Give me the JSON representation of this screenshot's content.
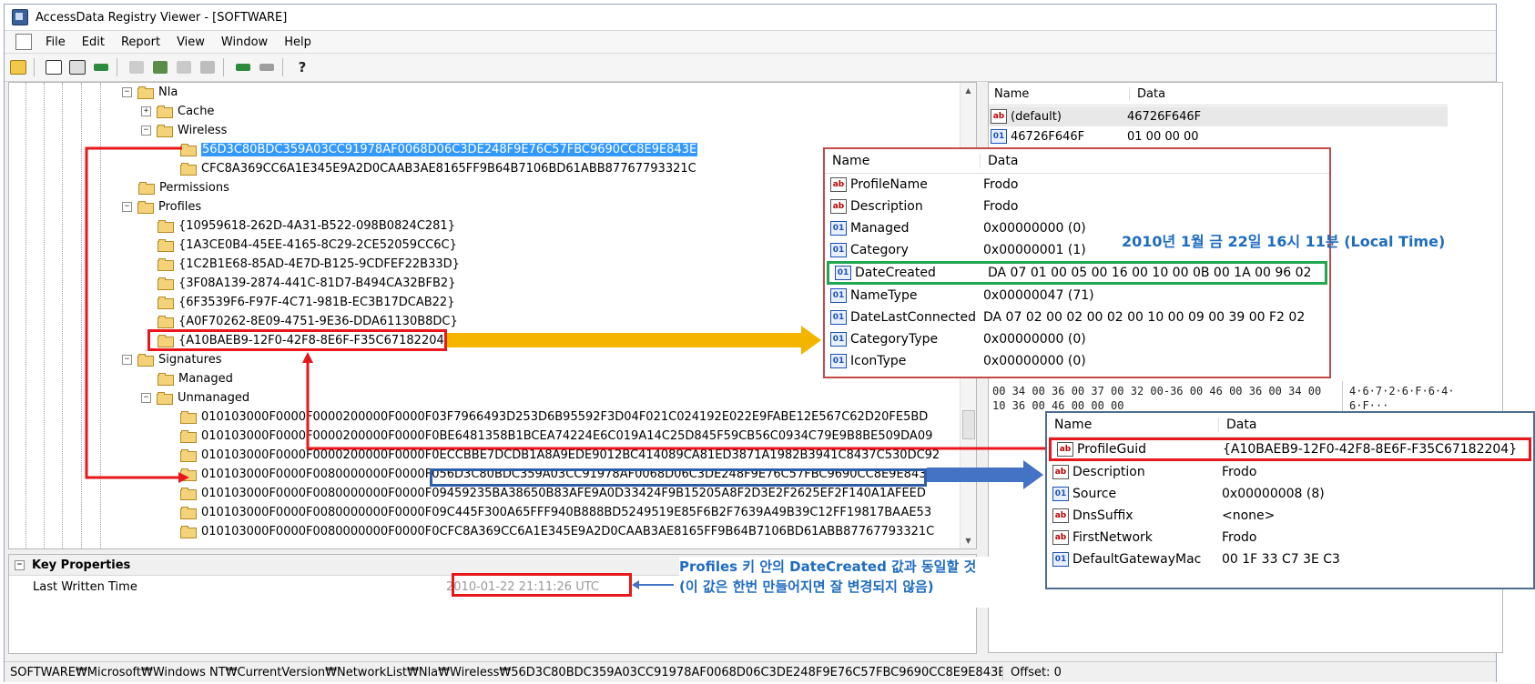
{
  "window": {
    "title": "AccessData Registry Viewer - [SOFTWARE]"
  },
  "menu": {
    "items": [
      "File",
      "Edit",
      "Report",
      "View",
      "Window",
      "Help"
    ]
  },
  "toolbar": {
    "icons": [
      "open-folder-icon",
      "report-icon",
      "export-icon",
      "key-icon",
      "disabled-icon",
      "find-icon",
      "properties-icon",
      "search-icon",
      "connect-icon",
      "disconnect-icon",
      "help-icon"
    ]
  },
  "tree": {
    "nodes": [
      {
        "label": "Nla",
        "expander": "−"
      },
      {
        "label": "Cache",
        "expander": "+"
      },
      {
        "label": "Wireless",
        "expander": "−"
      },
      {
        "label": "56D3C80BDC359A03CC91978AF0068D06C3DE248F9E76C57FBC9690CC8E9E843E",
        "expander": ""
      },
      {
        "label": "CFC8A369CC6A1E345E9A2D0CAAB3AE8165FF9B64B7106BD61ABB87767793321C",
        "expander": ""
      },
      {
        "label": "Permissions",
        "expander": ""
      },
      {
        "label": "Profiles",
        "expander": "−"
      },
      {
        "label": "{10959618-262D-4A31-B522-098B0824C281}",
        "expander": ""
      },
      {
        "label": "{1A3CE0B4-45EE-4165-8C29-2CE52059CC6C}",
        "expander": ""
      },
      {
        "label": "{1C2B1E68-85AD-4E7D-B125-9CDFEF22B33D}",
        "expander": ""
      },
      {
        "label": "{3F08A139-2874-441C-81D7-B494CA32BFB2}",
        "expander": ""
      },
      {
        "label": "{6F3539F6-F97F-4C71-981B-EC3B17DCAB22}",
        "expander": ""
      },
      {
        "label": "{A0F70262-8E09-4751-9E36-DDA61130B8DC}",
        "expander": ""
      },
      {
        "label": "{A10BAEB9-12F0-42F8-8E6F-F35C67182204}",
        "expander": ""
      },
      {
        "label": "Signatures",
        "expander": "−"
      },
      {
        "label": "Managed",
        "expander": ""
      },
      {
        "label": "Unmanaged",
        "expander": "−"
      },
      {
        "label": "010103000F0000F0000200000F0000F03F7966493D253D6B95592F3D04F021C024192E022E9FABE12E567C62D20FE5BD",
        "expander": ""
      },
      {
        "label": "010103000F0000F0000200000F0000F0BE6481358B1BCEA74224E6C019A14C25D845F59CB56C0934C79E9B8BE509DA09",
        "expander": ""
      },
      {
        "label": "010103000F0000F0000200000F0000F0ECCBBE7DCDB1A8A9EDE9012BC414089CA81ED3871A1982B3941C8437C530DC92",
        "expander": ""
      },
      {
        "label": "010103000F0000F0080000000F0000F056D3C80BDC359A03CC91978AF0068D06C3DE248F9E76C57FBC9690CC8E9E843E",
        "expander": ""
      },
      {
        "label": "010103000F0000F0080000000F0000F09459235BA38650B83AFE9A0D33424F9B15205A8F2D3E2F2625EF2F140A1AFEED",
        "expander": ""
      },
      {
        "label": "010103000F0000F0080000000F0000F09C445F300A65FFF940B888BD5249519E85F6B2F7639A49B39C12FF19817BAAE53",
        "expander": ""
      },
      {
        "label": "010103000F0000F0080000000F0000F0CFC8A369CC6A1E345E9A2D0CAAB3AE8165FF9B64B7106BD61ABB87767793321C",
        "expander": ""
      }
    ]
  },
  "key_properties": {
    "header": "Key Properties",
    "expander": "−",
    "last_written_label": "Last Written Time",
    "last_written_value": "2010-01-22 21:11:26 UTC"
  },
  "right_pane": {
    "col_name": "Name",
    "col_data": "Data",
    "rows": [
      {
        "name": "(default)",
        "data": "46726F646F",
        "type": "ab"
      },
      {
        "name": "46726F646F",
        "data": "01 00 00 00",
        "type": "bin"
      }
    ],
    "hex_line1": "00  34 00 36 00 37 00 32 00-36 00 46 00 36 00 34 00",
    "hex_line2": "10  36 00 46 00 00 00",
    "ascii_line1": "4·6·7·2·6·F·6·4·",
    "ascii_line2": "6·F···"
  },
  "popup_profile": {
    "col_name": "Name",
    "col_data": "Data",
    "rows": [
      {
        "name": "ProfileName",
        "data": "Frodo",
        "type": "ab"
      },
      {
        "name": "Description",
        "data": "Frodo",
        "type": "ab"
      },
      {
        "name": "Managed",
        "data": "0x00000000 (0)",
        "type": "bin"
      },
      {
        "name": "Category",
        "data": "0x00000001 (1)",
        "type": "bin"
      },
      {
        "name": "DateCreated",
        "data": "DA 07 01 00 05 00 16 00 10 00 0B 00 1A 00 96 02",
        "type": "bin"
      },
      {
        "name": "NameType",
        "data": "0x00000047 (71)",
        "type": "bin"
      },
      {
        "name": "DateLastConnected",
        "data": "DA 07 02 00 02 00 02 00 10 00 09 00 39 00 F2 02",
        "type": "bin"
      },
      {
        "name": "CategoryType",
        "data": "0x00000000 (0)",
        "type": "bin"
      },
      {
        "name": "IconType",
        "data": "0x00000000 (0)",
        "type": "bin"
      }
    ]
  },
  "popup_signature": {
    "col_name": "Name",
    "col_data": "Data",
    "rows": [
      {
        "name": "ProfileGuid",
        "data": "{A10BAEB9-12F0-42F8-8E6F-F35C67182204}",
        "type": "ab"
      },
      {
        "name": "Description",
        "data": "Frodo",
        "type": "ab"
      },
      {
        "name": "Source",
        "data": "0x00000008 (8)",
        "type": "bin"
      },
      {
        "name": "DnsSuffix",
        "data": "<none>",
        "type": "ab"
      },
      {
        "name": "FirstNetwork",
        "data": "Frodo",
        "type": "ab"
      },
      {
        "name": "DefaultGatewayMac",
        "data": "00 1F 33 C7 3E C3",
        "type": "bin"
      }
    ]
  },
  "annotations": {
    "date_decoded": "2010년 1월 금 22일 16시 11분 (Local Time)",
    "note_line1": "Profiles 키 안의 DateCreated 값과 동일할 것",
    "note_line2": "(이 값은 한번 만들어지면 잘 변경되지 않음)"
  },
  "statusbar": {
    "path": "SOFTWARE₩Microsoft₩Windows NT₩CurrentVersion₩NetworkList₩Nla₩Wireless₩56D3C80BDC359A03CC91978AF0068D06C3DE248F9E76C57FBC9690CC8E9E843E",
    "offset": "Offset: 0"
  },
  "colors": {
    "highlight_red": "#e8171b",
    "highlight_green": "#1fa84f",
    "highlight_blue": "#2f5ea8",
    "arrow_yellow": "#f5b400",
    "arrow_blue": "#4472c4",
    "annotation_blue": "#1f6cc0",
    "selection": "#3399ff"
  }
}
